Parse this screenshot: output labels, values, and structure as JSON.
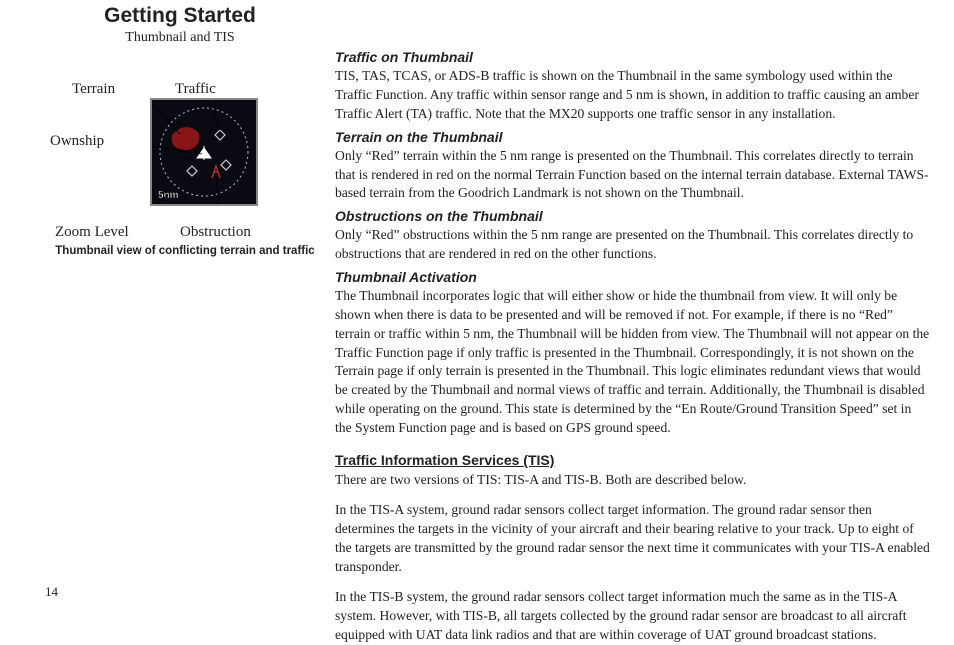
{
  "header": {
    "title": "Getting Started",
    "subtitle": "Thumbnail and TIS"
  },
  "figure": {
    "labels": {
      "terrain": "Terrain",
      "traffic": "Traffic",
      "ownship": "Ownship",
      "zoom": "Zoom Level",
      "obstruction": "Obstruction",
      "range_text": "5nm"
    },
    "caption": "Thumbnail view of conflicting terrain and traffic"
  },
  "sections": {
    "traffic_thumb": {
      "heading": "Traffic on Thumbnail",
      "body": "TIS, TAS, TCAS, or ADS-B traffic is shown on the Thumbnail in the same symbology used within the Traffic Function. Any traffic within sensor range and 5 nm is shown, in addition to traffic causing an amber Traffic Alert (TA) traffic. Note that the MX20 supports one traffic sensor in any installation."
    },
    "terrain_thumb": {
      "heading": "Terrain on the Thumbnail",
      "body": "Only “Red” terrain within the 5 nm range is presented on the Thumbnail. This correlates directly to terrain that is rendered in red on the normal Terrain Function based on the internal terrain database. External TAWS-based terrain from the Goodrich Landmark is not shown on the Thumbnail."
    },
    "obstructions_thumb": {
      "heading": "Obstructions on the Thumbnail",
      "body": "Only “Red” obstructions within the 5 nm range are presented on the Thumbnail. This correlates directly to obstructions that are rendered in red on the other functions."
    },
    "activation": {
      "heading": "Thumbnail Activation",
      "body": "The Thumbnail incorporates logic that will either show or hide the thumbnail from view. It will only be shown when there is data to be presented and will be removed if not. For example, if there is no “Red” terrain or traffic within 5 nm, the Thumbnail will be hidden from view. The Thumbnail will not appear on the Traffic Function page if only traffic is presented in the Thumbnail. Correspondingly, it is not shown on the Terrain page if only terrain is presented in the Thumbnail. This logic eliminates redundant views that would be created by the Thumbnail and normal views of traffic and terrain. Additionally, the Thumbnail is disabled while operating on the ground. This state is determined by the “En Route/Ground Transition Speed” set in the System Function page and is based on GPS ground speed."
    },
    "tis": {
      "heading": "Traffic Information Services (TIS)",
      "p1": "There are two versions of TIS:  TIS-A and TIS-B. Both are described below.",
      "p2": "In the TIS-A system, ground radar sensors collect target information. The ground radar sensor then determines the targets in the vicinity of your aircraft and their bearing relative to your track. Up to eight of the targets are transmitted by the ground radar sensor the next time it communicates with your TIS-A enabled transponder.",
      "p3": "In the TIS-B system, the ground radar sensors collect target information much the same as in the TIS-A system. However, with TIS-B, all targets collected by the ground radar sensor are broadcast to all aircraft equipped with UAT data link radios and that are within coverage of UAT ground broadcast stations."
    }
  },
  "page_number": "14"
}
